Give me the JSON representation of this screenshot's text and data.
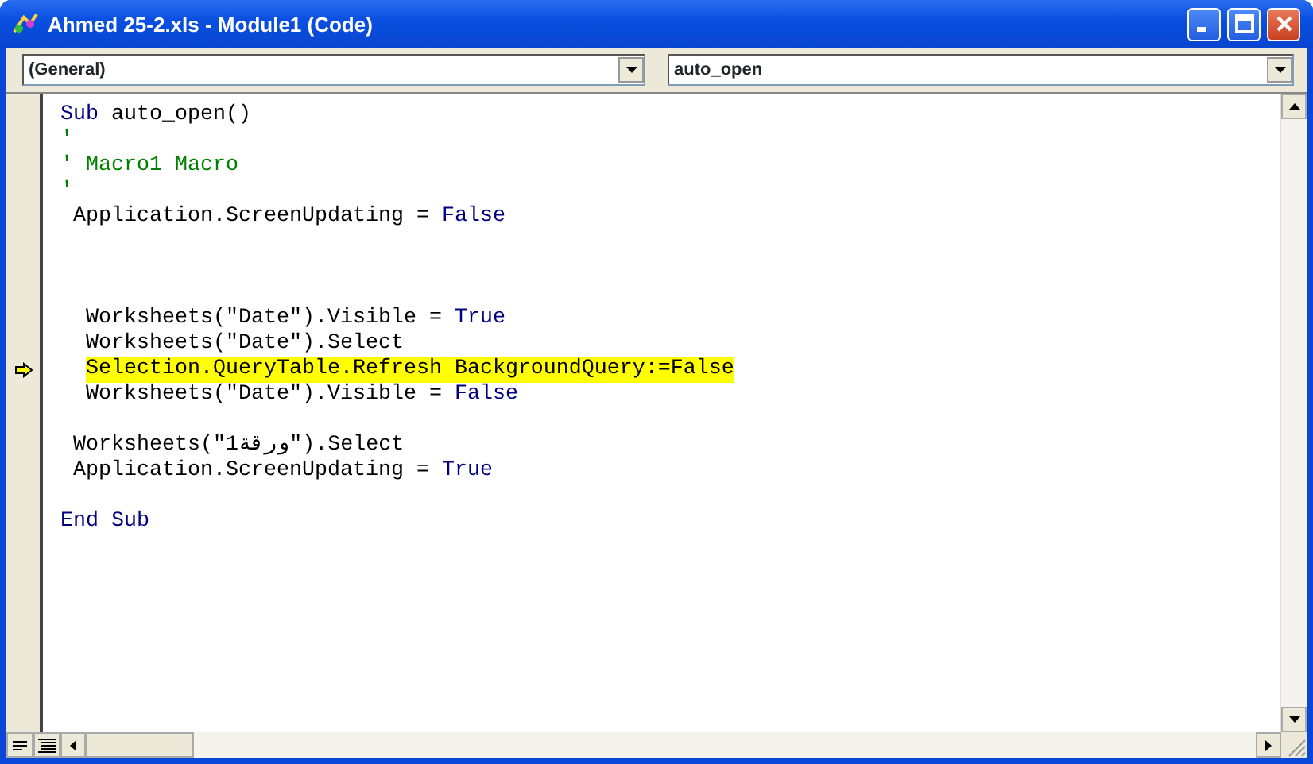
{
  "window": {
    "title": "Ahmed 25-2.xls - Module1 (Code)"
  },
  "object_combo": {
    "value": "(General)"
  },
  "procedure_combo": {
    "value": "auto_open"
  },
  "code_lines": [
    {
      "kind": "code",
      "current": false,
      "tokens": [
        {
          "kind": "keyword",
          "text": "Sub"
        },
        {
          "kind": "plain",
          "text": " auto_open()"
        }
      ]
    },
    {
      "kind": "code",
      "current": false,
      "tokens": [
        {
          "kind": "comment",
          "text": "'"
        }
      ]
    },
    {
      "kind": "code",
      "current": false,
      "tokens": [
        {
          "kind": "comment",
          "text": "' Macro1 Macro"
        }
      ]
    },
    {
      "kind": "code",
      "current": false,
      "tokens": [
        {
          "kind": "comment",
          "text": "'"
        }
      ]
    },
    {
      "kind": "code",
      "current": false,
      "tokens": [
        {
          "kind": "plain",
          "text": " Application.ScreenUpdating = "
        },
        {
          "kind": "keyword",
          "text": "False"
        }
      ]
    },
    {
      "kind": "blank"
    },
    {
      "kind": "blank"
    },
    {
      "kind": "blank"
    },
    {
      "kind": "code",
      "current": false,
      "tokens": [
        {
          "kind": "plain",
          "text": "  Worksheets(\"Date\").Visible = "
        },
        {
          "kind": "keyword",
          "text": "True"
        }
      ]
    },
    {
      "kind": "code",
      "current": false,
      "tokens": [
        {
          "kind": "plain",
          "text": "  Worksheets(\"Date\").Select"
        }
      ]
    },
    {
      "kind": "code",
      "current": true,
      "tokens": [
        {
          "kind": "plain",
          "text": "  Selection.QueryTable.Refresh BackgroundQuery:=False"
        }
      ]
    },
    {
      "kind": "code",
      "current": false,
      "tokens": [
        {
          "kind": "plain",
          "text": "  Worksheets(\"Date\").Visible = "
        },
        {
          "kind": "keyword",
          "text": "False"
        }
      ]
    },
    {
      "kind": "blank"
    },
    {
      "kind": "code",
      "current": false,
      "tokens": [
        {
          "kind": "plain",
          "text": " Worksheets(\"ورقة1\").Select"
        }
      ]
    },
    {
      "kind": "code",
      "current": false,
      "tokens": [
        {
          "kind": "plain",
          "text": " Application.ScreenUpdating = "
        },
        {
          "kind": "keyword",
          "text": "True"
        }
      ]
    },
    {
      "kind": "blank"
    },
    {
      "kind": "code",
      "current": false,
      "tokens": [
        {
          "kind": "keyword",
          "text": "End Sub"
        }
      ]
    }
  ]
}
